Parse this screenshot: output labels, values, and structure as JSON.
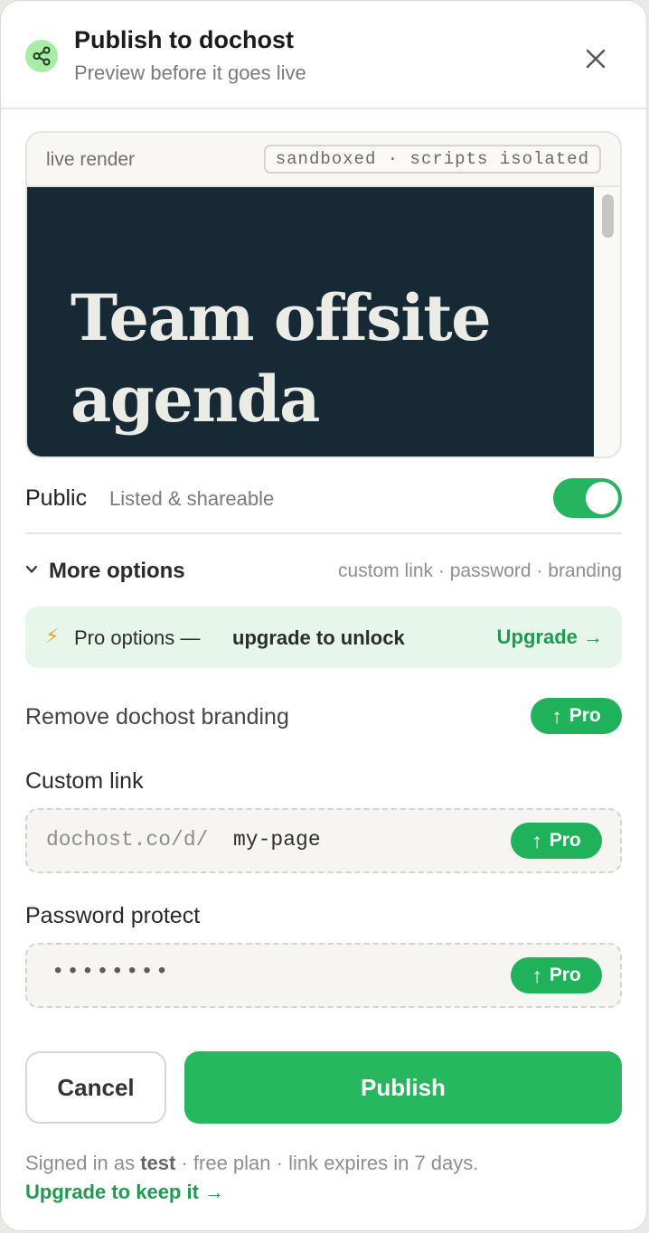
{
  "header": {
    "title": "Publish to dochost",
    "subtitle": "Preview before it goes live",
    "share_icon": "share-icon",
    "close_icon": "close-icon"
  },
  "preview": {
    "label": "live render",
    "sandbox_badge": "sandboxed · scripts isolated",
    "document_title": "Team offsite agenda"
  },
  "visibility": {
    "label": "Public",
    "description": "Listed & shareable",
    "enabled": true
  },
  "more_options": {
    "label": "More options",
    "hint": "custom link · password · branding",
    "expanded": true
  },
  "pro_banner": {
    "icon": "⚡",
    "text": "Pro options —",
    "text_bold": "upgrade to unlock",
    "link": "Upgrade →"
  },
  "branding": {
    "label": "Remove dochost branding",
    "pill": "Pro",
    "pill_arrow": "↑"
  },
  "custom_link": {
    "label": "Custom link",
    "prefix": "dochost.co/d/",
    "value": "my-page",
    "pill": "Pro",
    "pill_arrow": "↑"
  },
  "password": {
    "label": "Password protect",
    "value": "••••••••",
    "pill": "Pro",
    "pill_arrow": "↑"
  },
  "actions": {
    "cancel": "Cancel",
    "publish": "Publish"
  },
  "footer": {
    "signed_in_prefix": "Signed in as",
    "user": "test",
    "plan_info": "· free plan · link expires in 7 days.",
    "upgrade_link": "Upgrade to keep it →"
  },
  "colors": {
    "accent": "#26b75f",
    "accent_text": "#1f9a4e",
    "preview_bg": "#172935",
    "banner_bg": "#e6f6eb"
  }
}
